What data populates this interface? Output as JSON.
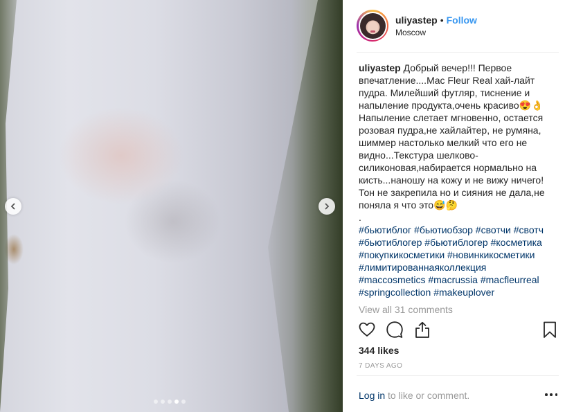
{
  "post": {
    "username": "uliyastep",
    "bullet": "•",
    "follow_label": "Follow",
    "location": "Moscow"
  },
  "caption": {
    "username": "uliyastep",
    "lines": [
      "Добрый вечер!!! Первое",
      "впечатление....Mac Fleur Real хай-лайт",
      "пудра. Милейший футляр, тиснение и",
      "напыление продукта,очень красиво😍👌",
      "Напыление слетает мгновенно, остается",
      "розовая пудра,не хайлайтер, не румяна,",
      "шиммер настолько мелкий что его не",
      "видно...Текстура шелково-",
      "силиконовая,набирается нормально на",
      "кисть...наношу на кожу и не вижу ничего!",
      "Тон не закрепила но и сияния не дала,не",
      "поняла я что это😅🤔",
      "."
    ],
    "hashtag_lines": [
      [
        "#бьютиблог",
        "#бьютиобзор",
        "#свотчи",
        "#свотч"
      ],
      [
        "#бьютиблогер",
        "#бьютиблогер",
        "#косметика"
      ],
      [
        "#покупкикосметики",
        "#новинкикосметики"
      ],
      [
        "#лимитированнаяколлекция"
      ],
      [
        "#maccosmetics",
        "#macrussia",
        "#macfleurreal"
      ],
      [
        "#springcollection",
        "#makeuplover"
      ]
    ]
  },
  "comments": {
    "view_all_label": "View all 31 comments"
  },
  "actions": {
    "like_icon": "heart-icon",
    "comment_icon": "comment-icon",
    "share_icon": "share-icon",
    "save_icon": "bookmark-icon"
  },
  "likes_label": "344 likes",
  "time_label": "7 DAYS AGO",
  "footer": {
    "login_label": "Log in",
    "login_suffix": " to like or comment."
  },
  "carousel": {
    "total": 5,
    "active_index": 3
  },
  "colors": {
    "link_blue": "#3897f0",
    "hashtag_blue": "#003569",
    "muted": "#999999"
  }
}
